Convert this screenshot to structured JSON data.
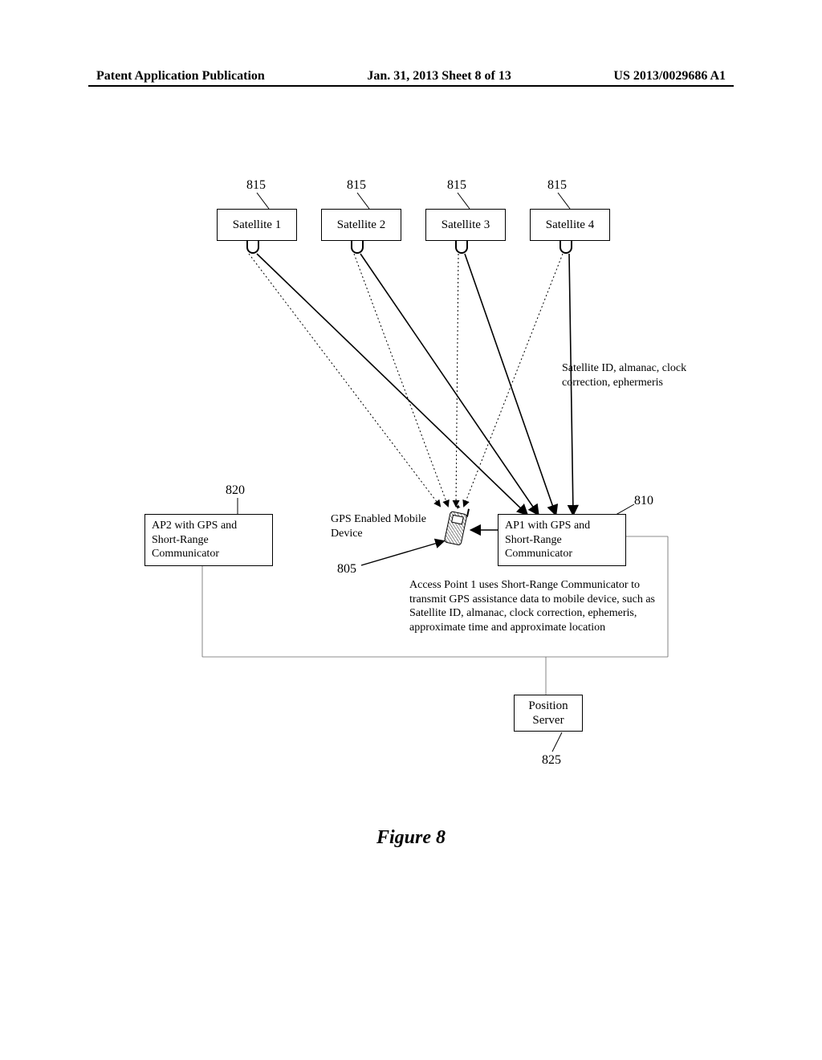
{
  "header": {
    "left": "Patent Application Publication",
    "center": "Jan. 31, 2013  Sheet 8 of 13",
    "right": "US 2013/0029686 A1"
  },
  "refs": {
    "r815": "815",
    "r820": "820",
    "r810": "810",
    "r805": "805",
    "r825": "825"
  },
  "satellites": {
    "s1": "Satellite 1",
    "s2": "Satellite 2",
    "s3": "Satellite 3",
    "s4": "Satellite 4"
  },
  "ap1": {
    "line1": "AP1 with GPS and",
    "line2": "Short-Range",
    "line3": "Communicator"
  },
  "ap2": {
    "line1": "AP2 with GPS and",
    "line2": "Short-Range",
    "line3": "Communicator"
  },
  "position_server": {
    "line1": "Position",
    "line2": "Server"
  },
  "labels": {
    "sat_data": "Satellite ID, almanac, clock correction, ephermeris",
    "gps_device": "GPS Enabled Mobile Device",
    "ap_desc": "Access Point 1 uses Short-Range Communicator to transmit GPS assistance data to mobile device, such as Satellite ID, almanac, clock correction, ephemeris, approximate time and approximate location"
  },
  "figure": "Figure 8"
}
